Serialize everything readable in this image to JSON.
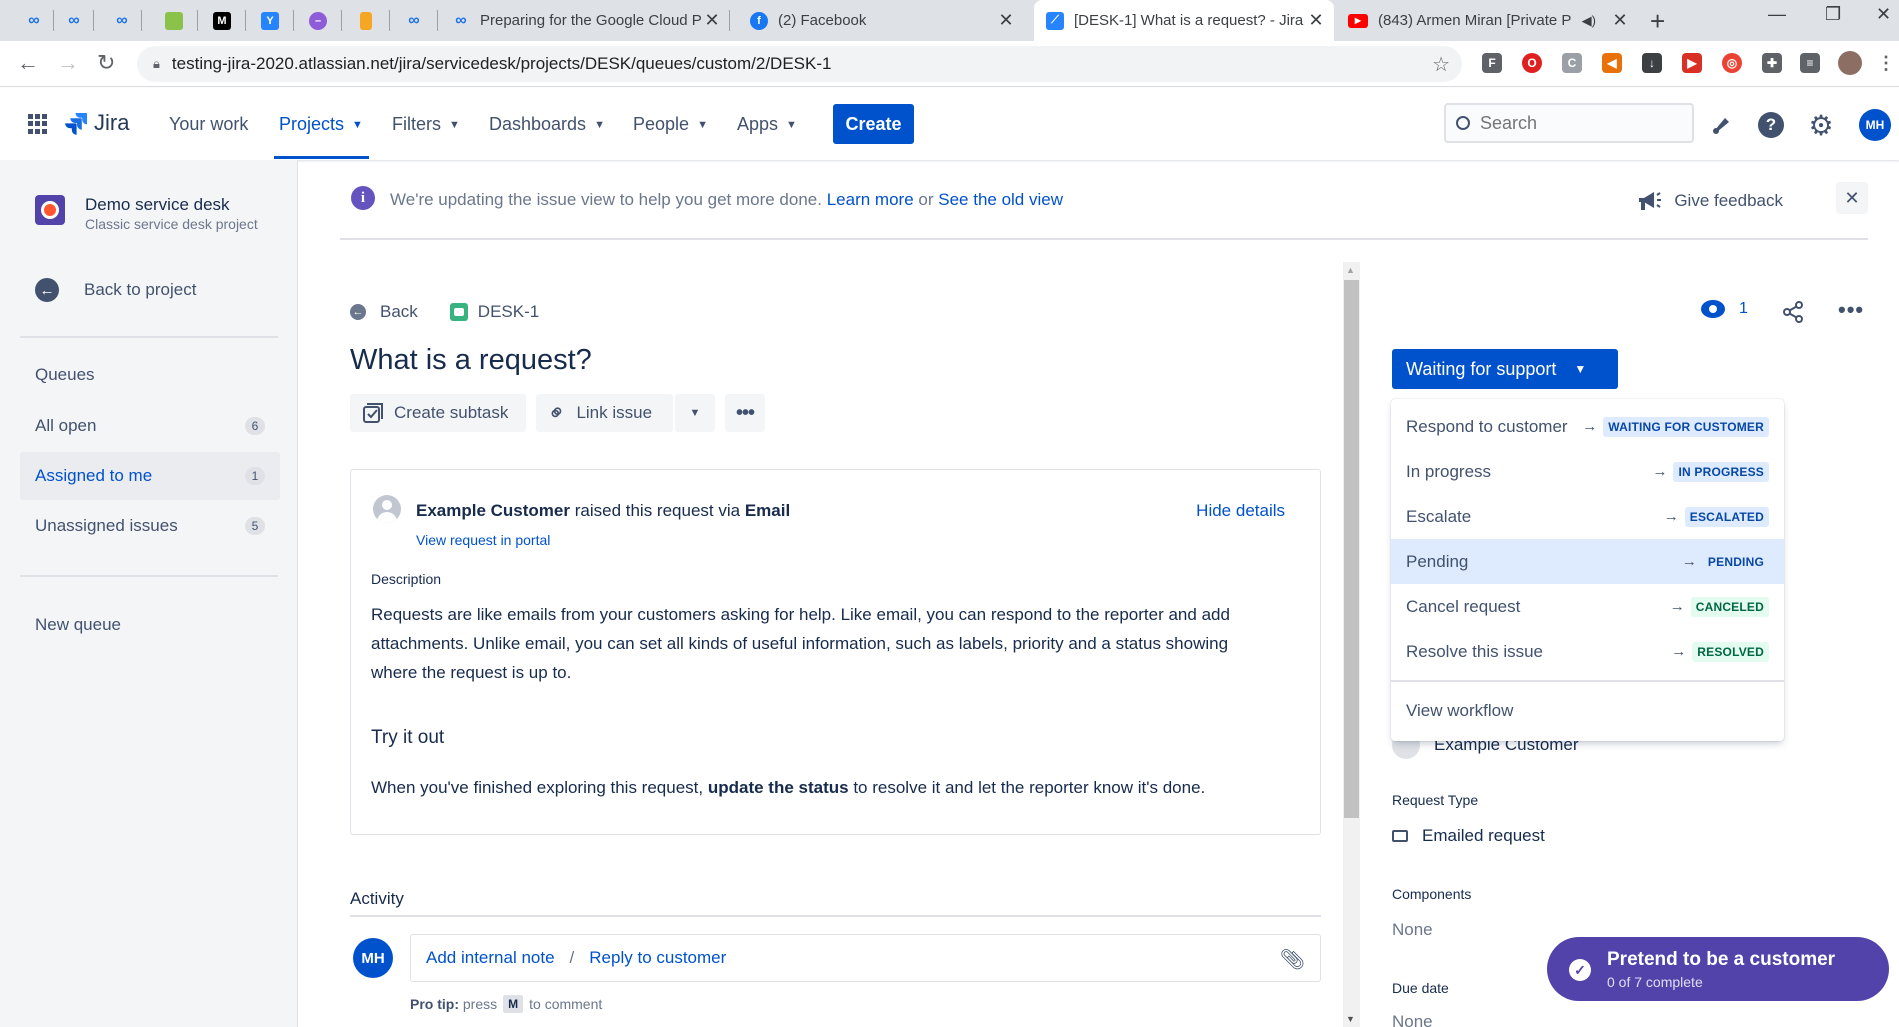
{
  "browser": {
    "tabs": [
      {
        "title": "",
        "icon": "infinity-icon"
      },
      {
        "title": "",
        "icon": "infinity-icon"
      },
      {
        "title": "",
        "icon": "infinity-icon"
      },
      {
        "title": "",
        "icon": "green-square-icon"
      },
      {
        "title": "",
        "icon": "medium-icon"
      },
      {
        "title": "",
        "icon": "y-icon"
      },
      {
        "title": "",
        "icon": "purple-circle-icon"
      },
      {
        "title": "",
        "icon": "bookmark-icon"
      },
      {
        "title": "",
        "icon": "infinity-icon"
      },
      {
        "title": "Preparing for the Google Cloud P",
        "icon": "infinity-icon"
      },
      {
        "title": "(2) Facebook",
        "icon": "facebook-icon"
      },
      {
        "title": "[DESK-1] What is a request? - Jira",
        "icon": "jira-icon"
      },
      {
        "title": "(843) Armen Miran [Private P",
        "icon": "youtube-icon"
      }
    ],
    "url": "testing-jira-2020.atlassian.net/jira/servicedesk/projects/DESK/queues/custom/2/DESK-1"
  },
  "jira_nav": {
    "product": "Jira",
    "items": [
      "Your work",
      "Projects",
      "Filters",
      "Dashboards",
      "People",
      "Apps"
    ],
    "create": "Create",
    "search_placeholder": "Search",
    "avatar_initials": "MH"
  },
  "sidebar": {
    "project_name": "Demo service desk",
    "project_type": "Classic service desk project",
    "back": "Back to project",
    "queues_heading": "Queues",
    "queues": [
      {
        "label": "All open",
        "count": "6"
      },
      {
        "label": "Assigned to me",
        "count": "1"
      },
      {
        "label": "Unassigned issues",
        "count": "5"
      }
    ],
    "new_queue": "New queue"
  },
  "banner": {
    "text": "We're updating the issue view to help you get more done.",
    "learn_more": "Learn more",
    "or": "or",
    "old_view": "See the old view",
    "feedback": "Give feedback"
  },
  "issue": {
    "back": "Back",
    "key": "DESK-1",
    "title": "What is a request?",
    "create_subtask": "Create subtask",
    "link_issue": "Link issue",
    "reporter": "Example Customer",
    "raised_via_text": "raised this request via",
    "channel": "Email",
    "view_portal": "View request in portal",
    "hide_details": "Hide details",
    "description_label": "Description",
    "description": "Requests are like emails from your customers asking for help. Like email, you can respond to the reporter and add attachments. Unlike email, you can set all kinds of useful information, such as labels, priority and a status showing where the request is up to.",
    "try_heading": "Try it out",
    "try_pre": "When you've finished exploring this request,",
    "try_bold": "update the status",
    "try_post": "to resolve it and let the reporter know it's done."
  },
  "activity": {
    "heading": "Activity",
    "avatar": "MH",
    "internal_note": "Add internal note",
    "slash": "/",
    "reply": "Reply to customer",
    "protip_label": "Pro tip:",
    "protip_press": "press",
    "protip_key": "M",
    "protip_end": "to comment"
  },
  "right_panel": {
    "watchers": "1",
    "status": "Waiting for support",
    "transitions": [
      {
        "label": "Respond to customer",
        "target": "WAITING FOR CUSTOMER",
        "color": "blue"
      },
      {
        "label": "In progress",
        "target": "IN PROGRESS",
        "color": "blue"
      },
      {
        "label": "Escalate",
        "target": "ESCALATED",
        "color": "blue"
      },
      {
        "label": "Pending",
        "target": "PENDING",
        "color": "blue"
      },
      {
        "label": "Cancel request",
        "target": "CANCELED",
        "color": "green"
      },
      {
        "label": "Resolve this issue",
        "target": "RESOLVED",
        "color": "green"
      }
    ],
    "view_workflow": "View workflow",
    "reporter_name": "Example Customer",
    "request_type_label": "Request Type",
    "request_type": "Emailed request",
    "components_label": "Components",
    "components": "None",
    "due_date_label": "Due date",
    "due_date": "None"
  },
  "toast": {
    "title": "Pretend to be a customer",
    "progress": "0 of 7 complete"
  },
  "colors": {
    "jira_blue": "#0052cc",
    "purple": "#5243aa",
    "highlight": "#deebff"
  }
}
